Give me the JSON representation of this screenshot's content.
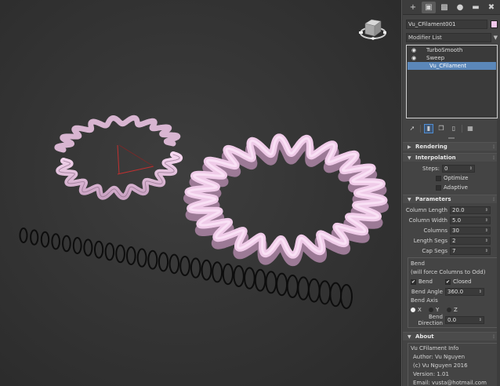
{
  "panel": {
    "tabs": [
      "+",
      "modify",
      "hierarchy",
      "motion",
      "display",
      "utilities"
    ],
    "object_name": "Vu_CFilament001",
    "object_color": "#f2c8ec",
    "modifier_list_label": "Modifier List",
    "stack": [
      {
        "name": "TurboSmooth",
        "visible": true,
        "selected": false
      },
      {
        "name": "Sweep",
        "visible": true,
        "selected": false
      },
      {
        "name": "Vu_CFilament",
        "visible": false,
        "selected": true
      }
    ],
    "rollouts": {
      "rendering": "Rendering",
      "interpolation": "Interpolation",
      "parameters": "Parameters",
      "about": "About"
    },
    "interpolation": {
      "steps_label": "Steps:",
      "steps_value": "0",
      "optimize_label": "Optimize",
      "adaptive_label": "Adaptive"
    },
    "parameters": {
      "column_length_label": "Column Length",
      "column_length_value": "20.0",
      "column_width_label": "Column Width",
      "column_width_value": "5.0",
      "columns_label": "Columns",
      "columns_value": "30",
      "length_segs_label": "Length Segs",
      "length_segs_value": "2",
      "cap_segs_label": "Cap Segs",
      "cap_segs_value": "7",
      "bend_group_label": "Bend",
      "bend_note": "(will force Columns to Odd)",
      "bend_check_label": "Bend",
      "closed_check_label": "Closed",
      "bend_angle_label": "Bend Angle",
      "bend_angle_value": "360.0",
      "bend_axis_label": "Bend Axis",
      "axis_x": "X",
      "axis_y": "Y",
      "axis_z": "Z",
      "bend_direction_label": "Bend Direction",
      "bend_direction_value": "0.0"
    },
    "about": {
      "group_label": "Vu CFilament Info",
      "author": "Author: Vu Nguyen",
      "copyright": "(c) Vu Nguyen 2016",
      "version": "Version: 1.01",
      "email": "Email: vusta@hotmail.com"
    }
  }
}
